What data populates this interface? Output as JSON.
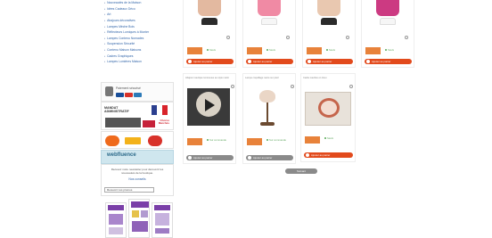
{
  "sidebar": {
    "categories": [
      "Nouveautés de la Maison",
      "Idées Cadeaux Déco",
      "Art",
      "Abajours décoratives",
      "Lampes Mèche Bois",
      "Réflecteurs Lumiques à Monter",
      "Lampes Contenu Nomades",
      "Suspension Sécurité",
      "Contenu Maison Maisons",
      "Cadres Graphiques",
      "Lampes Lumières Maison"
    ],
    "payment": {
      "title": "Paiement sécurisé",
      "card_colors": [
        "#1a4f9a",
        "#d8322a",
        "#f3a51b",
        "#2c7ab8"
      ]
    },
    "mandat": {
      "title_line1": "MANDAT",
      "title_line2": "ADMINISTRATIF",
      "gov_label_line1": "Chorus",
      "gov_label_line2": "Marchés"
    },
    "webfluence": {
      "logo": "webfluence",
      "description": "Recevez notre newsletter pour découvrir les nouveautés de la boutique.",
      "link": "Nos conseils",
      "select_value": "Recevoir nos promos"
    }
  },
  "products": [
    {
      "name": "",
      "stock": "Stock",
      "cart_label": "Ajouter au panier",
      "cart_style": "orange",
      "shade_color": "#e3b9a0"
    },
    {
      "name": "",
      "stock": "Stock",
      "cart_label": "Ajouter au panier",
      "cart_style": "orange",
      "shade_color": "#f08aa4"
    },
    {
      "name": "",
      "stock": "Stock",
      "cart_label": "Ajouter au panier",
      "cart_style": "orange",
      "shade_color": "#e9c8b0"
    },
    {
      "name": "",
      "stock": "Stock",
      "cart_label": "Ajouter au panier",
      "cart_style": "orange",
      "shade_color": "#cc3a82"
    },
    {
      "name": "Abajour nautique lumineuse au style marin",
      "stock": "Sur commande",
      "cart_label": "Ajouter au panier",
      "cart_style": "gray"
    },
    {
      "name": "Lampe coquillage nacre sur pied",
      "stock": "Sur commande",
      "cart_label": "Ajouter au panier",
      "cart_style": "gray"
    },
    {
      "name": "Cadre nautilus en tissu",
      "stock": "Stock",
      "cart_label": "Ajouter au panier",
      "cart_style": "orange"
    }
  ],
  "pagination": {
    "more_label": "Suivant"
  },
  "colors": {
    "accent_orange": "#e24a1c",
    "price_tag": "#e8823a",
    "link_blue": "#3366aa",
    "button_gray": "#8a8a8a"
  }
}
